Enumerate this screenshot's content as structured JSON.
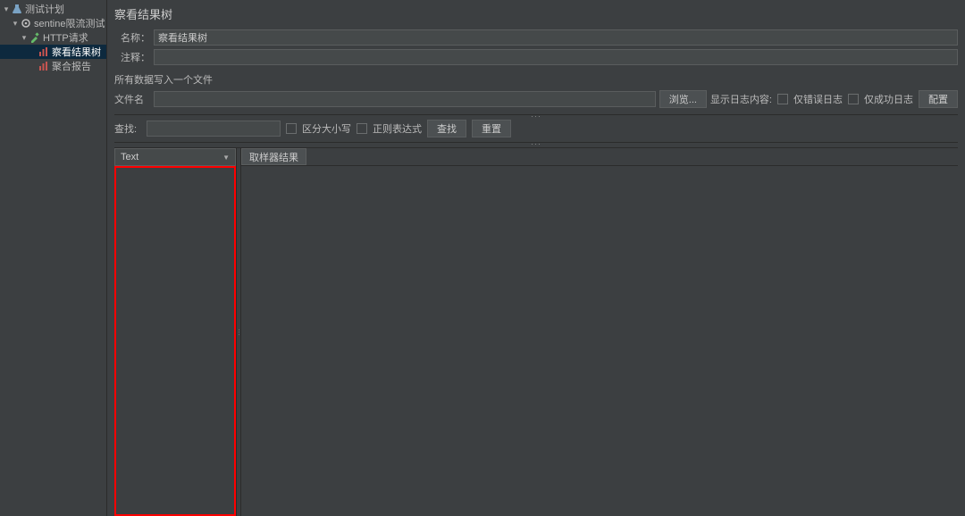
{
  "tree": {
    "items": [
      {
        "indent": 0,
        "toggle": "▾",
        "icon": "flask",
        "label": "测试计划",
        "selected": false,
        "iconColor": "#7aa3c4"
      },
      {
        "indent": 1,
        "toggle": "▾",
        "icon": "gear",
        "label": "sentine限流测试",
        "selected": false,
        "iconColor": "#c0c0c0"
      },
      {
        "indent": 2,
        "toggle": "▾",
        "icon": "http",
        "label": "HTTP请求",
        "selected": false,
        "iconColor": "#66bb6a"
      },
      {
        "indent": 3,
        "toggle": "",
        "icon": "chart",
        "label": "察看结果树",
        "selected": true,
        "iconColor": "#c75450"
      },
      {
        "indent": 3,
        "toggle": "",
        "icon": "chart",
        "label": "聚合报告",
        "selected": false,
        "iconColor": "#c75450"
      }
    ]
  },
  "page": {
    "title": "察看结果树",
    "name_label": "名称：",
    "name_value": "察看结果树",
    "comment_label": "注释：",
    "comment_value": ""
  },
  "file_section": {
    "caption": "所有数据写入一个文件",
    "filename_label": "文件名",
    "filename_value": "",
    "browse_label": "浏览...",
    "show_log_label": "显示日志内容:",
    "only_error_label": "仅错误日志",
    "only_success_label": "仅成功日志",
    "config_label": "配置"
  },
  "search": {
    "label": "查找:",
    "value": "",
    "case_label": "区分大小写",
    "regex_label": "正则表达式",
    "find_label": "查找",
    "reset_label": "重置"
  },
  "result": {
    "renderer_value": "Text",
    "sampler_tab": "取样器结果"
  }
}
